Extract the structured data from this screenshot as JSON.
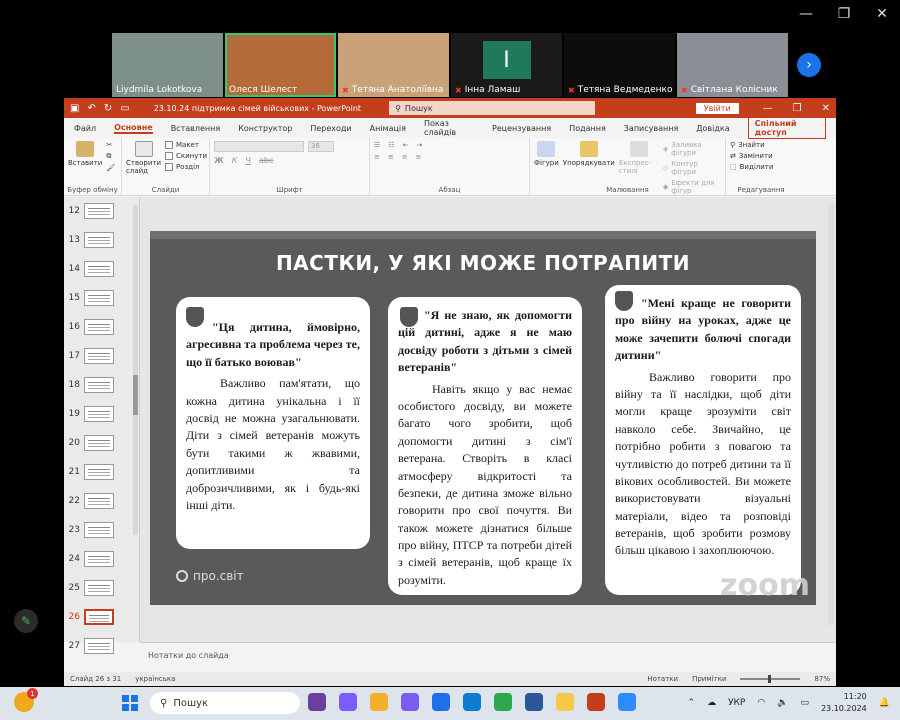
{
  "zoom_window": {
    "controls": [
      "—",
      "❐",
      "✕"
    ]
  },
  "participants": [
    {
      "name": "Liydmila Lokotkova",
      "muted": false,
      "bg": "#7d8f8a"
    },
    {
      "name": "Олеся Шелест",
      "muted": false,
      "bg": "#b56a3a",
      "active": true
    },
    {
      "name": "Тетяна Анатоліївна",
      "muted": true,
      "bg": "#caa27a"
    },
    {
      "name": "Інна Ламаш",
      "muted": true,
      "bg": "#1a1a1a",
      "letter": "I"
    },
    {
      "name": "Тетяна Ведмеденко",
      "muted": true,
      "bg": "#0d0d0d"
    },
    {
      "name": "Світлана Колісник",
      "muted": true,
      "bg": "#8a8f96"
    }
  ],
  "ppt": {
    "doc_title": "23.10.24 підтримка сімей військових  -  PowerPoint",
    "search_placeholder": "Пошук",
    "signin": "Увійти",
    "tabs": [
      "Файл",
      "Основне",
      "Вставлення",
      "Конструктор",
      "Переходи",
      "Анімація",
      "Показ слайдів",
      "Рецензування",
      "Подання",
      "Записування",
      "Довідка"
    ],
    "selected_tab": "Основне",
    "share": "Спільний доступ",
    "ribbon": {
      "paste": "Вставити",
      "clipboard": "Буфер обміну",
      "new_slide": "Створити слайд",
      "layout": "Макет",
      "reset": "Скинути",
      "section": "Розділ",
      "slides": "Слайди",
      "font_size": "36",
      "font": "Шрифт",
      "paragraph": "Абзац",
      "shapes": "Фігури",
      "arrange": "Упорядкувати",
      "quick_styles": "Експрес-стилі",
      "fill": "Заливка фігури",
      "outline": "Контур фігури",
      "effects": "Ефекти для фігур",
      "drawing": "Малювання",
      "find": "Знайти",
      "replace": "Замінити",
      "select": "Виділити",
      "editing": "Редагування"
    },
    "slide_numbers": [
      "12",
      "13",
      "14",
      "15",
      "16",
      "17",
      "18",
      "19",
      "20",
      "21",
      "22",
      "23",
      "24",
      "25",
      "26",
      "27"
    ],
    "current_slide": "26",
    "slide": {
      "title": "ПАСТКИ, У ЯКІ МОЖЕ ПОТРАПИТИ",
      "cards": [
        {
          "quote": "\"Ця дитина, ймовірно, агресивна та проблема через те, що її батько воював\"",
          "body": "Важливо пам'ятати, що кожна дитина унікальна і її досвід не можна узагальнювати. Діти з сімей ветеранів можуть бути такими ж жвавими, допитливими та доброзичливими, як і будь-які інші діти."
        },
        {
          "quote": "\"Я не знаю, як допомогти цій дитині, адже я не маю досвіду роботи з дітьми з сімей ветеранів\"",
          "body": "Навіть якщо у вас немає особистого досвіду, ви можете багато чого зробити, щоб допомогти дитині з сім'ї ветерана. Створіть в класі атмосферу відкритості та безпеки, де дитина зможе вільно говорити про свої почуття. Ви також можете дізнатися більше про війну, ПТСР та потреби дітей з сімей ветеранів, щоб краще їх розуміти."
        },
        {
          "quote": "\"Мені краще не говорити про війну на уроках, адже це може зачепити болючі спогади дитини\"",
          "body": "Важливо говорити про війну та її наслідки, щоб діти могли краще зрозуміти світ навколо себе. Звичайно, це потрібно робити з повагою та чутливістю до потреб дитини та її вікових особливостей. Ви можете використовувати візуальні матеріали, відео та розповіді ветеранів, щоб зробити розмову більш цікавою і захоплюючою."
        }
      ],
      "logo": "про.світ",
      "watermark": "zoom"
    },
    "notes_placeholder": "Нотатки до слайда",
    "status": {
      "slide_info": "Слайд 26 з 31",
      "language": "українська",
      "notes": "Нотатки",
      "comments": "Примітки",
      "zoom": "87%"
    }
  },
  "taskbar": {
    "notif_count": "1",
    "search": "Пошук",
    "lang": "УКР",
    "time": "11:20",
    "date": "23.10.2024",
    "app_colors": [
      "#6b3fa0",
      "#7b5cff",
      "#f3b02a",
      "#7a5cf0",
      "#1f6feb",
      "#0c7ad1",
      "#2aa84a",
      "#2b579a",
      "#f7c948",
      "#c43e1c",
      "#2d8cff"
    ]
  }
}
